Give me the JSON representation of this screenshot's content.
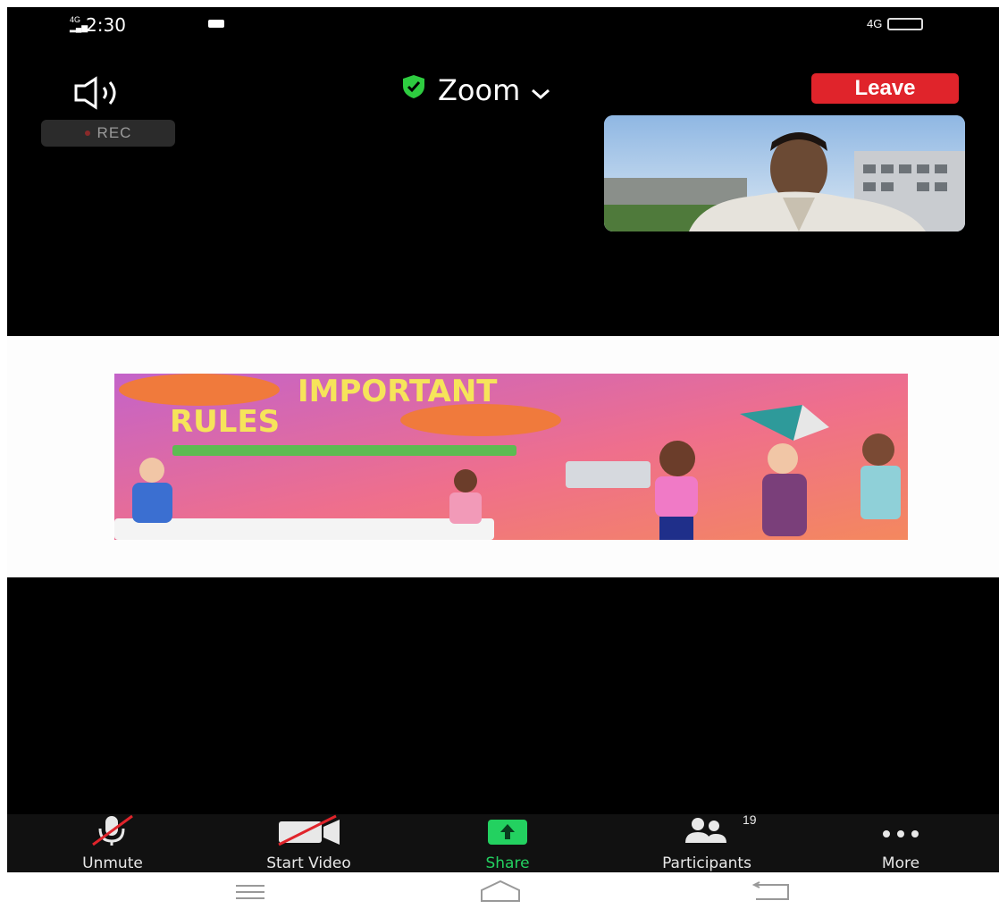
{
  "status_bar": {
    "time": "2:30",
    "network": "4G",
    "signal": "4G",
    "battery": ""
  },
  "header": {
    "meeting_title": "Zoom",
    "leave_label": "Leave"
  },
  "recording": {
    "label": "REC"
  },
  "shared_content": {
    "banner_title_line1": "IMPORTANT",
    "banner_title_line2": "RULES"
  },
  "toolbar": {
    "unmute_label": "Unmute",
    "start_video_label": "Start Video",
    "share_label": "Share",
    "participants_label": "Participants",
    "participants_count": "19",
    "more_label": "More"
  },
  "colors": {
    "leave_red": "#e0242b",
    "share_green": "#23d160",
    "shield_green": "#2ecc40"
  },
  "icons": [
    "speaker-icon",
    "shield-icon",
    "chevron-down-icon",
    "microphone-muted-icon",
    "video-off-icon",
    "share-arrow-icon",
    "participants-icon",
    "more-dots-icon",
    "menu-nav-icon",
    "home-nav-icon",
    "back-nav-icon"
  ]
}
